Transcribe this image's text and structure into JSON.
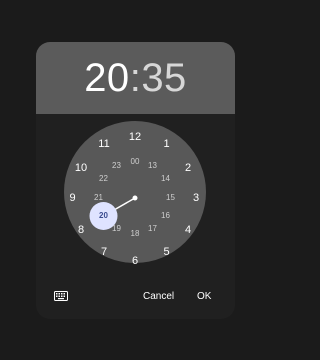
{
  "header": {
    "hour": "20",
    "separator": ":",
    "minute": "35"
  },
  "clock": {
    "selected_hour": "20",
    "outer_hours": [
      "12",
      "1",
      "2",
      "3",
      "4",
      "5",
      "6",
      "7",
      "8",
      "9",
      "10",
      "11"
    ],
    "inner_hours": [
      "00",
      "13",
      "14",
      "15",
      "16",
      "17",
      "18",
      "19",
      "20",
      "21",
      "22",
      "23"
    ]
  },
  "actions": {
    "keyboard_icon": "keyboard-icon",
    "cancel_label": "Cancel",
    "ok_label": "OK"
  },
  "colors": {
    "selector": "#dfe3ff",
    "selected_text": "#3a4b8f",
    "header_bg": "#5b5b5b",
    "dialog_bg": "#202020",
    "clock_bg": "#585858"
  }
}
